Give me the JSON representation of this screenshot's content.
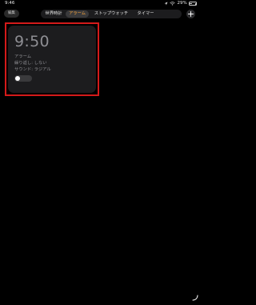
{
  "status_bar": {
    "time": "9:46",
    "battery_percent": "29%",
    "battery_level": 0.29,
    "icons": [
      "wifi-icon",
      "location-icon",
      "battery-icon"
    ]
  },
  "nav": {
    "edit_label": "編集",
    "tabs": [
      {
        "label": "世界時計",
        "active": false
      },
      {
        "label": "アラーム",
        "active": true
      },
      {
        "label": "ストップウォッチ",
        "active": false
      },
      {
        "label": "タイマー",
        "active": false
      }
    ],
    "add_icon": "plus-icon"
  },
  "alarm": {
    "time": "9:50",
    "label": "アラーム",
    "repeat": "繰り返し: しない",
    "sound": "サウンド: ラジアル",
    "enabled": false
  },
  "colors": {
    "background": "#000000",
    "accent": "#f4a23b",
    "card": "#1c1c1e",
    "highlight": "#d41a1a",
    "dim_text": "#8e8e93"
  }
}
